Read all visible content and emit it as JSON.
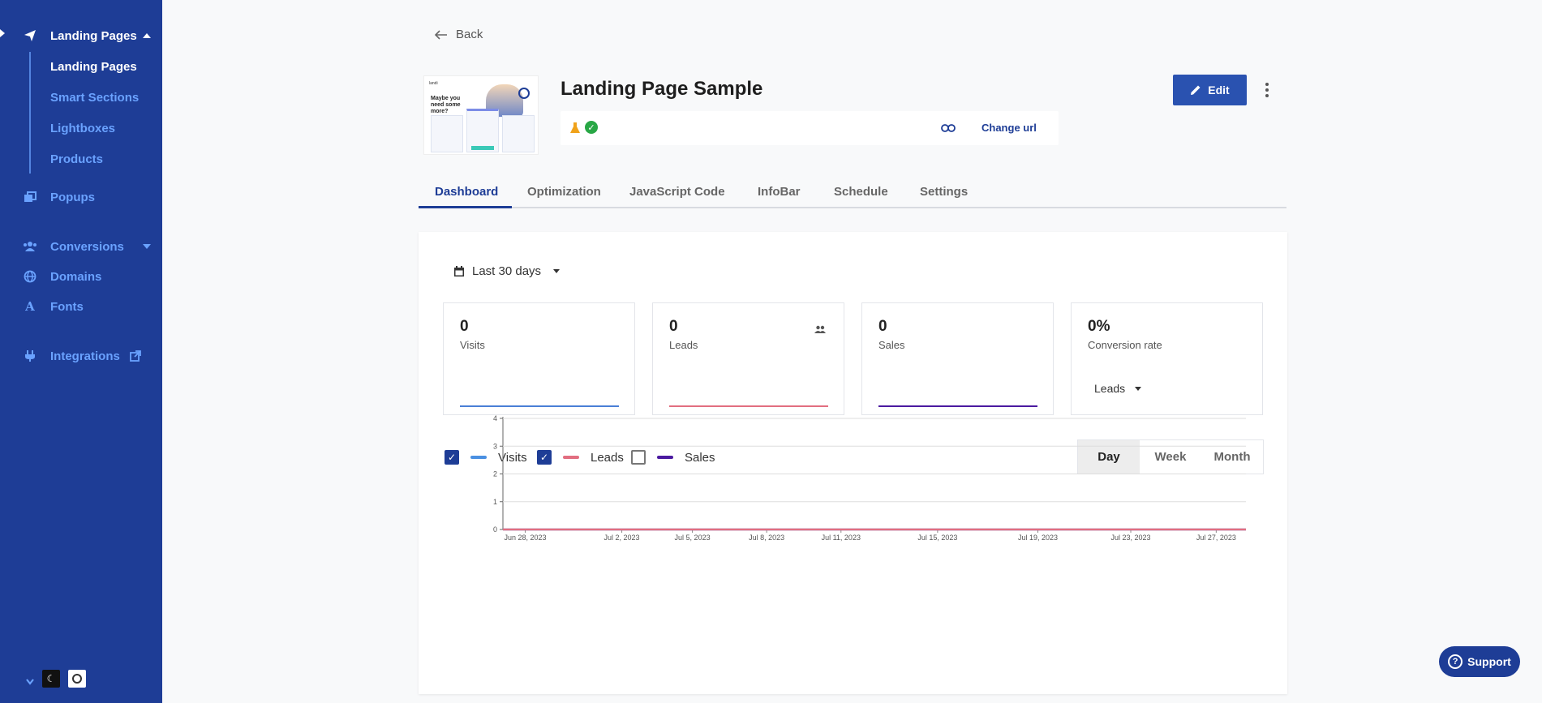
{
  "sidebar": {
    "items": [
      {
        "label": "Landing Pages",
        "icon": "paper-plane-icon"
      },
      {
        "label": "Popups",
        "icon": "popups-icon"
      },
      {
        "label": "Conversions",
        "icon": "users-icon"
      },
      {
        "label": "Domains",
        "icon": "globe-icon"
      },
      {
        "label": "Fonts",
        "icon": "font-icon"
      },
      {
        "label": "Integrations",
        "icon": "plug-icon"
      }
    ],
    "sub_items": [
      "Landing Pages",
      "Smart Sections",
      "Lightboxes",
      "Products"
    ]
  },
  "back_label": "Back",
  "page": {
    "title": "Landing Page Sample",
    "change_url_label": "Change url",
    "edit_label": "Edit",
    "thumbnail": {
      "heading": "Maybe you need some more?",
      "brand": "landi"
    }
  },
  "tabs": [
    "Dashboard",
    "Optimization",
    "JavaScript Code",
    "InfoBar",
    "Schedule",
    "Settings"
  ],
  "dashboard": {
    "range_label": "Last 30 days",
    "stats": [
      {
        "value": "0",
        "label": "Visits",
        "color": "#4a7fd6"
      },
      {
        "value": "0",
        "label": "Leads",
        "color": "#e26e80"
      },
      {
        "value": "0",
        "label": "Sales",
        "color": "#4b1aa0"
      },
      {
        "value": "0%",
        "label": "Conversion rate",
        "select": "Leads"
      }
    ],
    "legend": [
      {
        "label": "Visits",
        "checked": true,
        "color": "#4a90e2"
      },
      {
        "label": "Leads",
        "checked": true,
        "color": "#e26e80"
      },
      {
        "label": "Sales",
        "checked": false,
        "color": "#4b1aa0"
      }
    ],
    "period_options": [
      "Day",
      "Week",
      "Month"
    ],
    "period_selected": "Day"
  },
  "chart_data": {
    "type": "line",
    "x_ticks": [
      "Jun 28, 2023",
      "Jul 2, 2023",
      "Jul 5, 2023",
      "Jul 8, 2023",
      "Jul 11, 2023",
      "Jul 15, 2023",
      "Jul 19, 2023",
      "Jul 23, 2023",
      "Jul 27, 2023"
    ],
    "y_ticks": [
      0,
      1,
      2,
      3,
      4
    ],
    "ylim": [
      0,
      4
    ],
    "series": [
      {
        "name": "Visits",
        "values": [
          0,
          0,
          0,
          0,
          0,
          0,
          0,
          0,
          0
        ]
      },
      {
        "name": "Leads",
        "values": [
          0,
          0,
          0,
          0,
          0,
          0,
          0,
          0,
          0
        ]
      }
    ],
    "grid": true
  },
  "support_label": "Support",
  "colors": {
    "sidebar_bg": "#1e3d96",
    "accent": "#2a52b0",
    "link": "#6aa2ff"
  }
}
